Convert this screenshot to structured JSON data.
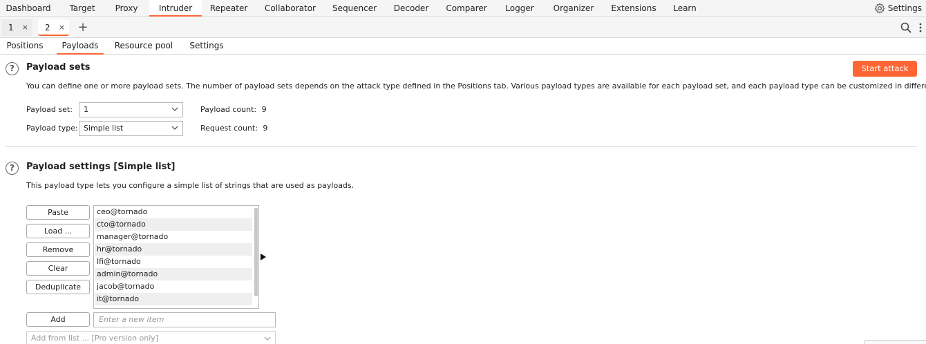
{
  "topnav": {
    "items": [
      "Dashboard",
      "Target",
      "Proxy",
      "Intruder",
      "Repeater",
      "Collaborator",
      "Sequencer",
      "Decoder",
      "Comparer",
      "Logger",
      "Organizer",
      "Extensions",
      "Learn"
    ],
    "active": "Intruder",
    "settings_label": "Settings",
    "settings_icon": "gear-icon"
  },
  "tabs": {
    "items": [
      {
        "label": "1",
        "close": "×"
      },
      {
        "label": "2",
        "close": "×"
      }
    ],
    "active": "2",
    "add_label": "+"
  },
  "subtabs": {
    "items": [
      "Positions",
      "Payloads",
      "Resource pool",
      "Settings"
    ],
    "active": "Payloads"
  },
  "payload_sets": {
    "help": "?",
    "title": "Payload sets",
    "start_attack_label": "Start attack",
    "description": "You can define one or more payload sets. The number of payload sets depends on the attack type defined in the Positions tab. Various payload types are available for each payload set, and each payload type can be customized in different ways.",
    "set_label": "Payload set:",
    "set_value": "1",
    "type_label": "Payload type:",
    "type_value": "Simple list",
    "payload_count_label": "Payload count:",
    "payload_count": "9",
    "request_count_label": "Request count:",
    "request_count": "9"
  },
  "payload_settings": {
    "help": "?",
    "title": "Payload settings [Simple list]",
    "description": "This payload type lets you configure a simple list of strings that are used as payloads.",
    "buttons": {
      "paste": "Paste",
      "load": "Load ...",
      "remove": "Remove",
      "clear": "Clear",
      "deduplicate": "Deduplicate",
      "add": "Add"
    },
    "list": [
      "ceo@tornado",
      "cto@tornado",
      "manager@tornado",
      "hr@tornado",
      "lfi@tornado",
      "admin@tornado",
      "jacob@tornado",
      "it@tornado"
    ],
    "new_item_placeholder": "Enter a new item",
    "add_from_list": "Add from list ... [Pro version only]"
  },
  "colors": {
    "accent": "#ff6633",
    "background": "#ffffff",
    "bar": "#f5f5f5"
  }
}
